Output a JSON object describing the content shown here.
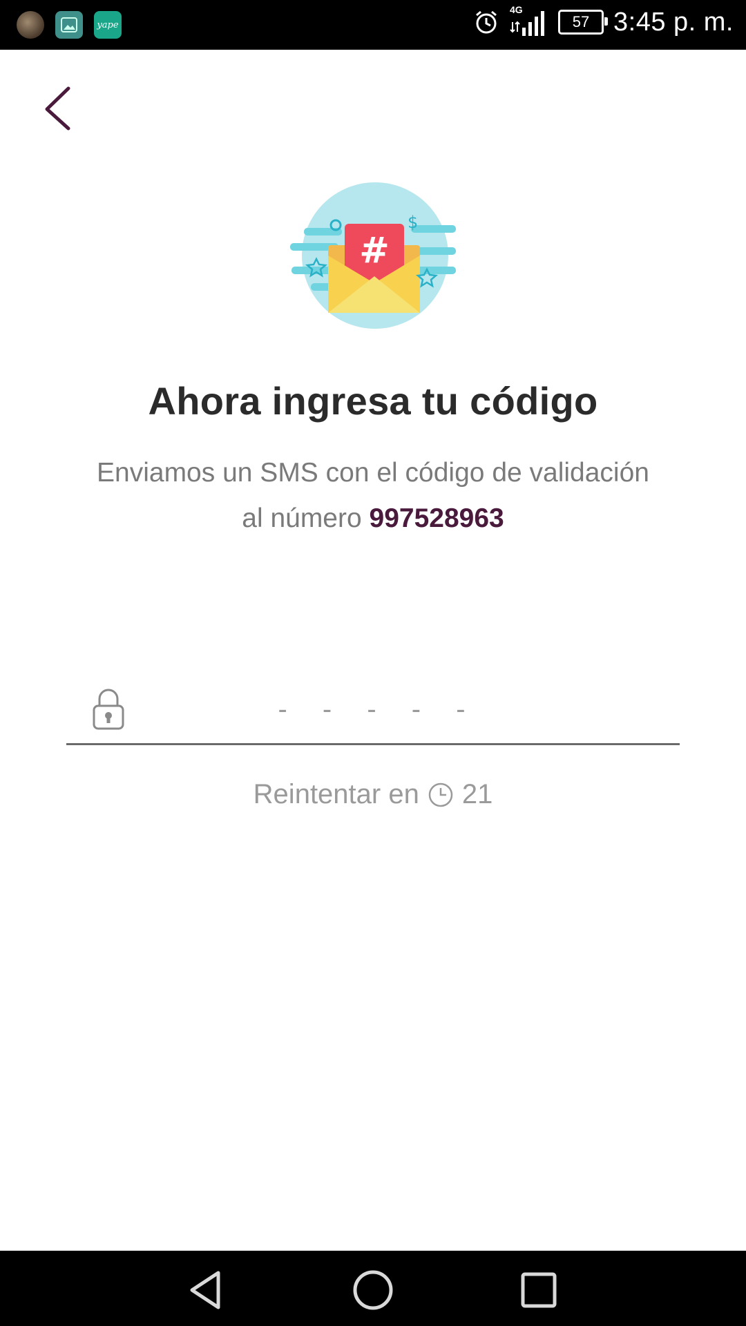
{
  "status_bar": {
    "time": "3:45 p. m.",
    "battery": "57",
    "network": "4G",
    "notification_icons": [
      "avatar",
      "gallery",
      "yape"
    ],
    "yape_label": "yape"
  },
  "header": {
    "back_icon": "chevron-left-icon"
  },
  "main": {
    "title": "Ahora ingresa tu código",
    "subtitle_line1": "Enviamos un SMS con el código de validación",
    "subtitle_line2_prefix": "al número",
    "phone_number": "997528963",
    "code_placeholder": "- - - - -",
    "retry_label": "Reintentar en",
    "retry_seconds": "21"
  },
  "colors": {
    "accent": "#4a1a3d",
    "text_dark": "#2b2b2b",
    "text_muted": "#7a7a7a"
  },
  "nav_bar": {
    "buttons": [
      "back-triangle-icon",
      "home-circle-icon",
      "recent-square-icon"
    ]
  }
}
